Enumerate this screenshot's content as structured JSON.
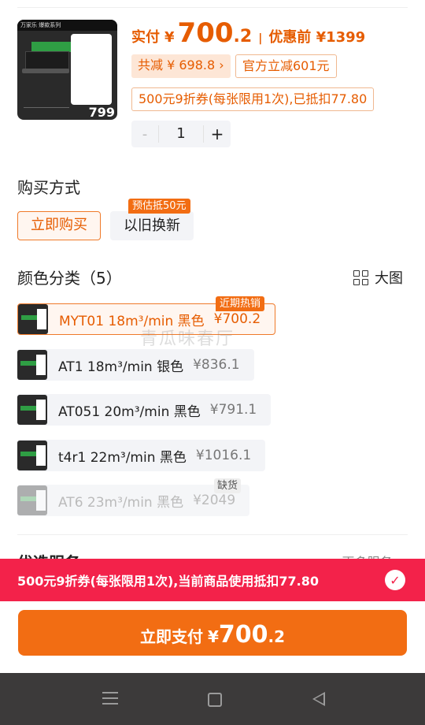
{
  "product": {
    "thumb_brand": "万家乐 爆款系列",
    "thumb_price": "799",
    "pay_label": "实付",
    "currency": "¥",
    "pay_int": "700",
    "pay_dec": ".2",
    "separator": "|",
    "pre_discount": "优惠前 ¥1399",
    "total_off": "共减 ¥ 698.8 ›",
    "official_off": "官方立减601元",
    "coupon_note": "500元9折券(每张限用1次),已抵扣77.80",
    "qty_minus": "-",
    "qty": "1",
    "qty_plus": "+"
  },
  "purchase": {
    "title": "购买方式",
    "options": [
      {
        "label": "立即购买",
        "selected": true
      },
      {
        "label": "以旧换新",
        "selected": false
      }
    ],
    "trade_badge": "预估抵50元"
  },
  "color": {
    "title": "颜色分类（5）",
    "bigview": "大图",
    "hot_badge": "近期热销",
    "oos_badge": "缺货",
    "items": [
      {
        "name": "MYT01 18m³/min 黑色",
        "price": "¥700.2",
        "state": "selected"
      },
      {
        "name": "AT1 18m³/min 银色",
        "price": "¥836.1",
        "state": "default"
      },
      {
        "name": "AT051 20m³/min 黑色",
        "price": "¥791.1",
        "state": "default"
      },
      {
        "name": "t4r1 22m³/min 黑色",
        "price": "¥1016.1",
        "state": "default"
      },
      {
        "name": "AT6 23m³/min 黑色",
        "price": "¥2049",
        "state": "out_of_stock"
      }
    ]
  },
  "watermark": "青瓜味春厅",
  "services": {
    "title": "优选服务",
    "more": "更多服务 ›"
  },
  "coupon_bar": {
    "text": "500元9折券(每张限用1次),当前商品使用抵扣77.80",
    "check": "✓"
  },
  "pay_button": {
    "label": "立即支付",
    "currency": "¥",
    "int": "700",
    "dec": ".2"
  },
  "colors": {
    "accent": "#f26d13",
    "coupon_red": "#f3224a",
    "nav_bg": "#3c3a3a"
  }
}
